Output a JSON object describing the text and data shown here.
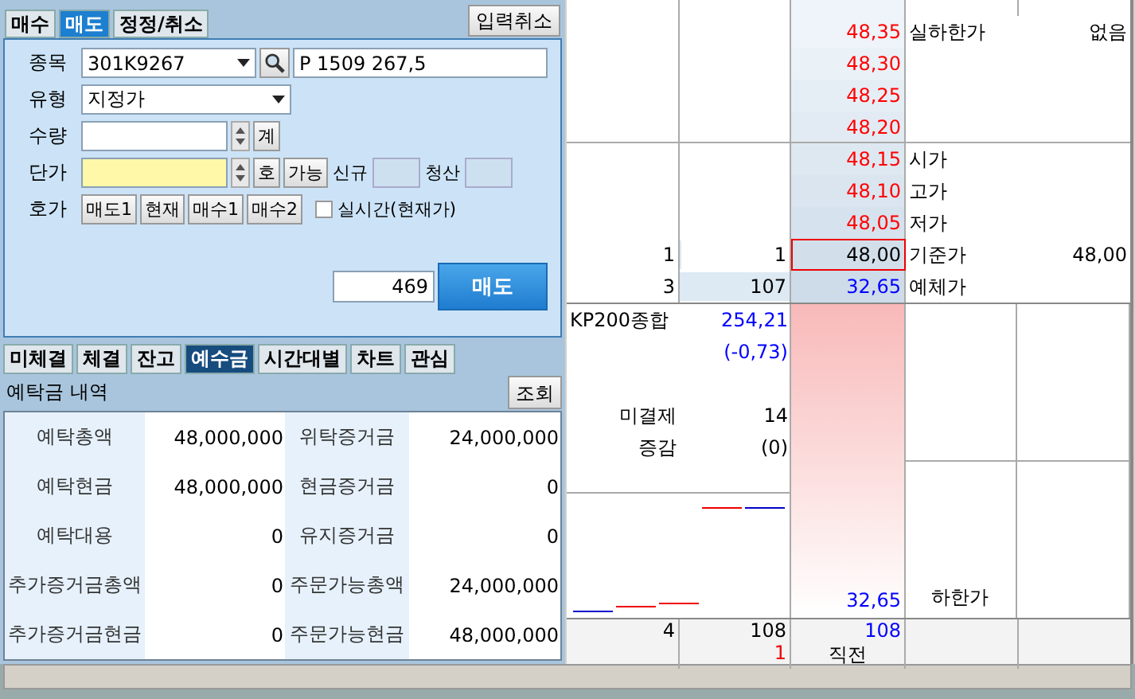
{
  "order_form": {
    "tabs": [
      {
        "label": "매수",
        "selected": false
      },
      {
        "label": "매도",
        "selected": true
      },
      {
        "label": "정정/취소",
        "selected": false
      }
    ],
    "cancel_button": "입력취소",
    "symbol_label": "종목",
    "symbol": "301K9267",
    "symbol_name": "P 1509 267,5",
    "type_label": "유형",
    "type": "지정가",
    "quantity_label": "수량",
    "calc_button": "계",
    "price_label": "단가",
    "tick_button": "호",
    "available_button": "가능",
    "new_label": "신규",
    "close_label": "청산",
    "quote_label": "호가",
    "quote_buttons": [
      "매도1",
      "현재",
      "매수1",
      "매수2"
    ],
    "realtime": {
      "label": "실시간(현재가)",
      "checked": false
    },
    "order_quantity": "469",
    "submit_button": "매도"
  },
  "account_tabs": [
    {
      "label": "미체결",
      "selected": false
    },
    {
      "label": "체결",
      "selected": false
    },
    {
      "label": "잔고",
      "selected": false
    },
    {
      "label": "예수금",
      "selected": true
    },
    {
      "label": "시간대별",
      "selected": false
    },
    {
      "label": "차트",
      "selected": false
    },
    {
      "label": "관심",
      "selected": false
    }
  ],
  "deposit": {
    "title": "예탁금 내역",
    "query_button": "조회",
    "rows": [
      {
        "label": "예탁총액",
        "value": "48,000,000",
        "label_2": "위탁증거금",
        "value_2": "24,000,000"
      },
      {
        "label": "예탁현금",
        "value": "48,000,000",
        "label_2": "현금증거금",
        "value_2": "0"
      },
      {
        "label": "예탁대용",
        "value": "0",
        "label_2": "유지증거금",
        "value_2": "0"
      },
      {
        "label": "추가증거금총액",
        "value": "0",
        "label_2": "주문가능총액",
        "value_2": "24,000,000"
      },
      {
        "label": "추가증거금현금",
        "value": "0",
        "label_2": "주문가능현금",
        "value_2": "48,000,000"
      }
    ]
  },
  "order_book": {
    "rows": [
      {
        "price": "48,35",
        "color": "#ff0000",
        "info_label": "실하한가",
        "info_value": "없음",
        "selected": false
      },
      {
        "price": "48,30",
        "color": "#ff0000",
        "selected": false
      },
      {
        "price": "48,25",
        "color": "#ff0000",
        "selected": false
      },
      {
        "price": "48,20",
        "color": "#ff0000",
        "selected": false
      },
      {
        "price": "48,15",
        "color": "#ff0000",
        "info_label": "시가",
        "selected": false
      },
      {
        "price": "48,10",
        "color": "#ff0000",
        "info_label": "고가",
        "selected": false
      },
      {
        "price": "48,05",
        "color": "#ff0000",
        "info_label": "저가",
        "selected": false
      },
      {
        "count": "1",
        "quantity": "1",
        "level": 0.01,
        "price": "48,00",
        "color": "#000000",
        "info_label": "기준가",
        "info_value": "48,00",
        "selected": true
      },
      {
        "count": "3",
        "quantity": "107",
        "level": 1,
        "price": "32,65",
        "color": "#0000ff",
        "info_label": "예체가",
        "selected": false
      }
    ],
    "index_label": "KP200종합",
    "index_value": "254,21",
    "index_change": "(-0,73)",
    "open_interest_label": "미결제",
    "open_interest": "14",
    "change_label": "증감",
    "change": "(0)",
    "low_price": "32,65",
    "low_label": "하한가",
    "footer": {
      "count": "4",
      "quantity": "108",
      "quantity_2": "1",
      "price_quantity": "108",
      "price_label": "직전"
    }
  }
}
